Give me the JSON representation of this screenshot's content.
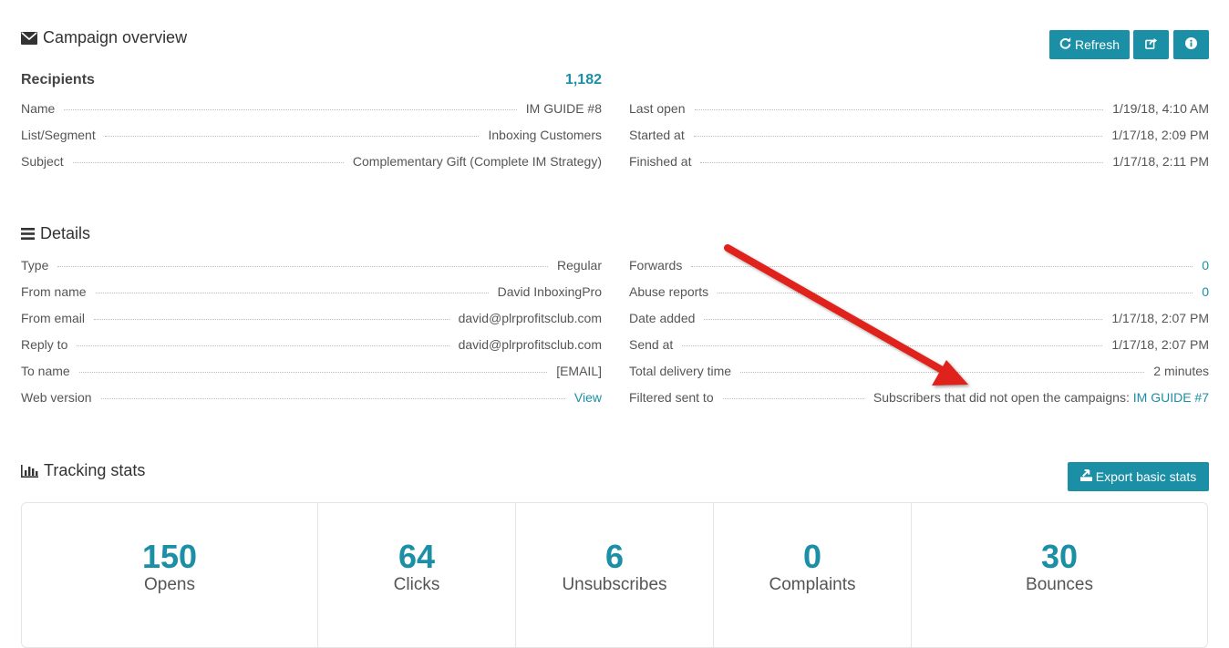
{
  "overview": {
    "title": "Campaign overview",
    "buttons": {
      "refresh": "Refresh"
    },
    "recipients_label": "Recipients",
    "recipients_value": "1,182",
    "left": [
      {
        "label": "Name",
        "value": "IM GUIDE #8"
      },
      {
        "label": "List/Segment",
        "value": "Inboxing Customers"
      },
      {
        "label": "Subject",
        "value": "Complementary Gift (Complete IM Strategy)"
      }
    ],
    "right": [
      {
        "label": "Last open",
        "value": "1/19/18, 4:10 AM"
      },
      {
        "label": "Started at",
        "value": "1/17/18, 2:09 PM"
      },
      {
        "label": "Finished at",
        "value": "1/17/18, 2:11 PM"
      }
    ]
  },
  "details": {
    "title": "Details",
    "left": [
      {
        "label": "Type",
        "value": "Regular"
      },
      {
        "label": "From name",
        "value": "David InboxingPro"
      },
      {
        "label": "From email",
        "value": "david@plrprofitsclub.com"
      },
      {
        "label": "Reply to",
        "value": "david@plrprofitsclub.com"
      },
      {
        "label": "To name",
        "value": "[EMAIL]"
      },
      {
        "label": "Web version",
        "value": "View"
      }
    ],
    "right": [
      {
        "label": "Forwards",
        "value": "0"
      },
      {
        "label": "Abuse reports",
        "value": "0"
      },
      {
        "label": "Date added",
        "value": "1/17/18, 2:07 PM"
      },
      {
        "label": "Send at",
        "value": "1/17/18, 2:07 PM"
      },
      {
        "label": "Total delivery time",
        "value": "2 minutes"
      },
      {
        "label": "Filtered sent to",
        "value_prefix": "Subscribers that did not open the campaigns: ",
        "value_link": "IM GUIDE #7"
      }
    ]
  },
  "tracking": {
    "title": "Tracking stats",
    "export_label": "Export basic stats",
    "stats": [
      {
        "value": "150",
        "label": "Opens"
      },
      {
        "value": "64",
        "label": "Clicks"
      },
      {
        "value": "6",
        "label": "Unsubscribes"
      },
      {
        "value": "0",
        "label": "Complaints"
      },
      {
        "value": "30",
        "label": "Bounces"
      }
    ]
  },
  "colors": {
    "accent": "#1a8fa5",
    "arrow": "#e0201a"
  }
}
